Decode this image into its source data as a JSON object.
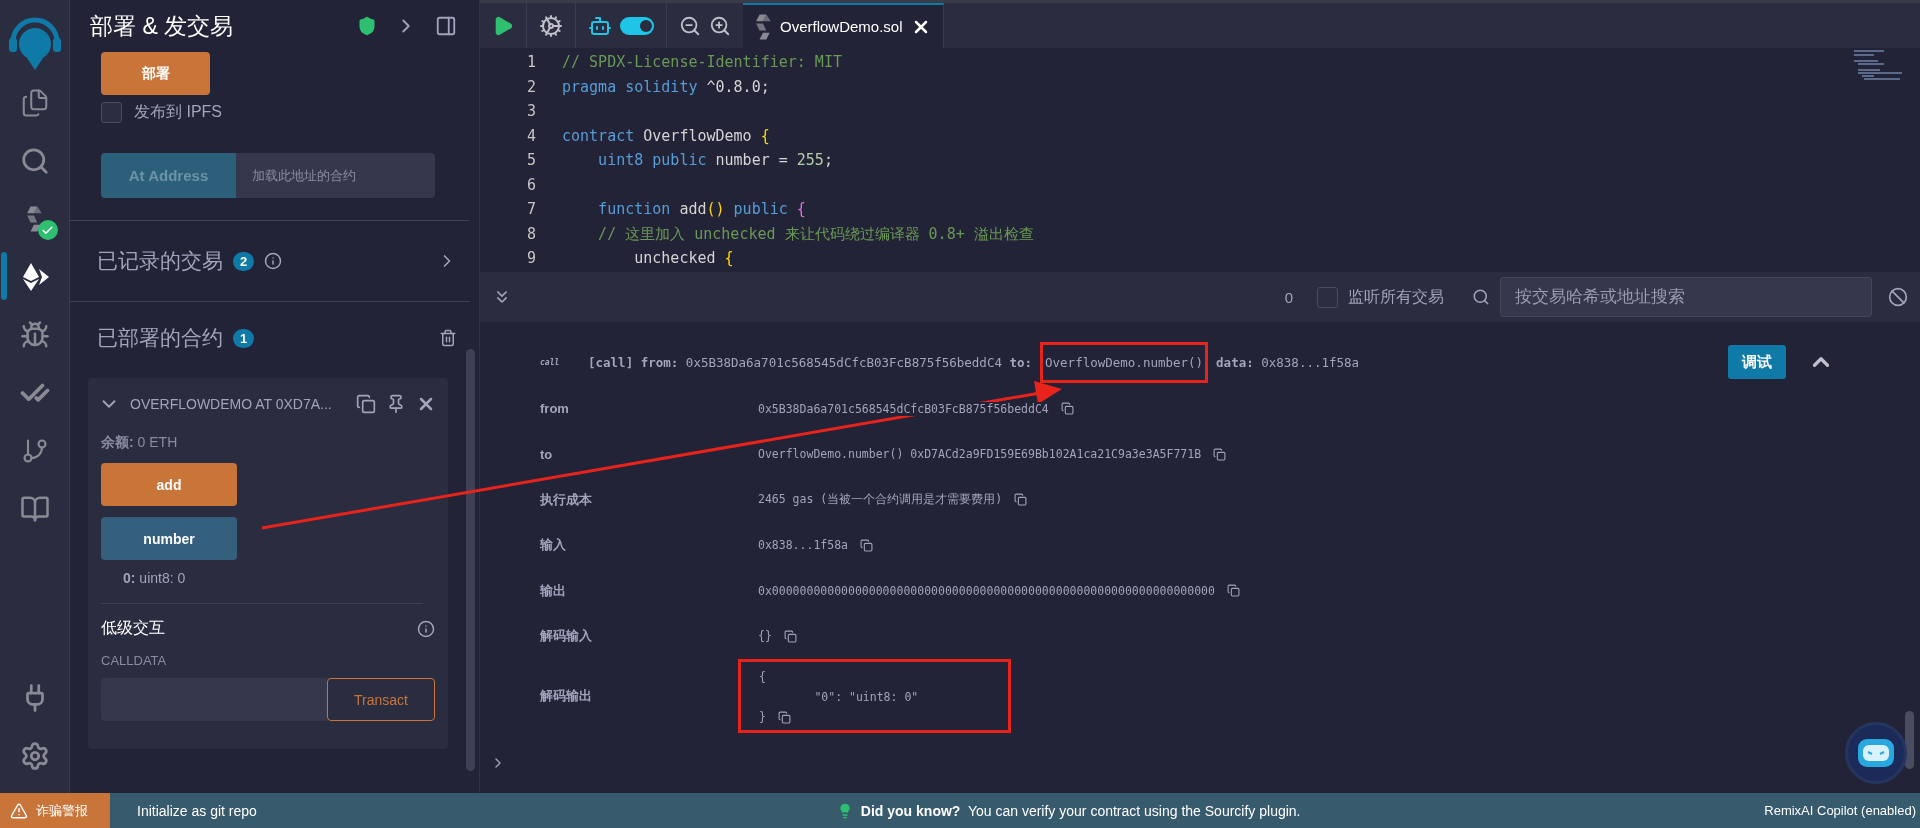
{
  "activity_bar": {
    "top": [
      {
        "kind": "files",
        "selected": false
      },
      {
        "kind": "search",
        "selected": false
      },
      {
        "kind": "compiler",
        "selected": false,
        "verified": true
      },
      {
        "kind": "deploy",
        "selected": true
      },
      {
        "kind": "debugger",
        "selected": false
      },
      {
        "kind": "tests",
        "selected": false
      },
      {
        "kind": "git",
        "selected": false
      },
      {
        "kind": "learn",
        "selected": false
      }
    ],
    "bottom": [
      {
        "kind": "plugins",
        "selected": false
      },
      {
        "kind": "settings",
        "selected": false
      }
    ]
  },
  "sidebar": {
    "title": "部署 & 发交易",
    "deploy_button": "部署",
    "publish": {
      "label": "发布到 IPFS",
      "checked": false
    },
    "at_address": {
      "button": "At Address",
      "placeholder": "加载此地址的合约"
    },
    "recorded": {
      "title": "已记录的交易",
      "count": "2"
    },
    "deployed": {
      "title": "已部署的合约",
      "count": "1",
      "contracts": [
        {
          "name": "OVERFLOWDEMO AT 0XD7A...",
          "expanded": true,
          "balance_label": "余额:",
          "balance": "0 ETH",
          "functions": [
            {
              "label": "add",
              "kind": "transact"
            },
            {
              "label": "number",
              "kind": "call"
            }
          ],
          "output": {
            "index": "0:",
            "value": "uint8: 0"
          },
          "low_level": {
            "title": "低级交互",
            "calldata_label": "CALLDATA",
            "button": "Transact"
          }
        }
      ]
    }
  },
  "editor": {
    "ai_toggle": {
      "on": true
    },
    "tabs": [
      {
        "label": "OverflowDemo.sol",
        "selected": true
      }
    ],
    "lines": [
      {
        "number": "1",
        "tokens": [
          {
            "text": "// SPDX-License-Identifier: MIT",
            "kind": "comment"
          }
        ]
      },
      {
        "number": "2",
        "tokens": [
          {
            "text": "pragma solidity",
            "kind": "keyword"
          },
          {
            "text": " ^0.8.0;",
            "kind": "plain"
          }
        ]
      },
      {
        "number": "3"
      },
      {
        "number": "4",
        "tokens": [
          {
            "text": "contract",
            "kind": "keyword"
          },
          {
            "text": " OverflowDemo ",
            "kind": "plain"
          },
          {
            "text": "{",
            "kind": "brace"
          }
        ]
      },
      {
        "number": "5",
        "tokens": [
          {
            "text": "    uint8",
            "kind": "keyword"
          },
          {
            "text": " public",
            "kind": "keyword"
          },
          {
            "text": " number = ",
            "kind": "plain"
          },
          {
            "text": "255",
            "kind": "number"
          },
          {
            "text": ";",
            "kind": "plain"
          }
        ]
      },
      {
        "number": "6"
      },
      {
        "number": "7",
        "tokens": [
          {
            "text": "    function",
            "kind": "keyword"
          },
          {
            "text": " add",
            "kind": "plain"
          },
          {
            "text": "()",
            "kind": "brace"
          },
          {
            "text": " public",
            "kind": "keyword"
          },
          {
            "text": " {",
            "kind": "brace2"
          }
        ]
      },
      {
        "number": "8",
        "tokens": [
          {
            "text": "    // 这里加入 unchecked 来让代码绕过编译器 0.8+ 溢出检查",
            "kind": "comment"
          }
        ]
      },
      {
        "number": "9",
        "tokens": [
          {
            "text": "        unchecked ",
            "kind": "plain"
          },
          {
            "text": "{",
            "kind": "brace"
          }
        ]
      }
    ]
  },
  "terminal": {
    "count": "0",
    "listen": {
      "label": "监听所有交易",
      "checked": false
    },
    "search": {
      "placeholder": "按交易哈希或地址搜索"
    },
    "transactions": [
      {
        "badge": "call",
        "tag": "[call]",
        "from_label": "from:",
        "from": "0x5B38Da6a701c568545dCfcB03FcB875f56beddC4",
        "to_label": "to:",
        "to": "OverflowDemo.number()",
        "to_highlighted": true,
        "data_label": "data:",
        "data": "0x838...1f58a",
        "debug_button": "调试",
        "expanded": true,
        "details": [
          {
            "label": "from",
            "kind": "text",
            "value": "0x5B38Da6a701c568545dCfcB03FcB875f56beddC4"
          },
          {
            "label": "to",
            "kind": "text",
            "value": "OverflowDemo.number() 0xD7ACd2a9FD159E69Bb102A1ca21C9a3e3A5F771B"
          },
          {
            "label": "执行成本",
            "kind": "text",
            "value": "2465 gas (当被一个合约调用是才需要费用)"
          },
          {
            "label": "输入",
            "kind": "text",
            "value": "0x838...1f58a"
          },
          {
            "label": "输出",
            "kind": "text",
            "value": "0x0000000000000000000000000000000000000000000000000000000000000000"
          },
          {
            "label": "解码输入",
            "kind": "text",
            "value": "{}"
          },
          {
            "label": "解码输出",
            "kind": "json",
            "highlighted": true,
            "lines": [
              "{",
              "        \"0\": \"uint8: 0\"",
              "}"
            ]
          }
        ]
      }
    ]
  },
  "status_bar": {
    "alert": "诈骗警报",
    "git": "Initialize as git repo",
    "tip_title": "Did you know?",
    "tip": "You can verify your contract using the Sourcify plugin.",
    "copilot": "RemixAI Copilot (enabled)"
  }
}
